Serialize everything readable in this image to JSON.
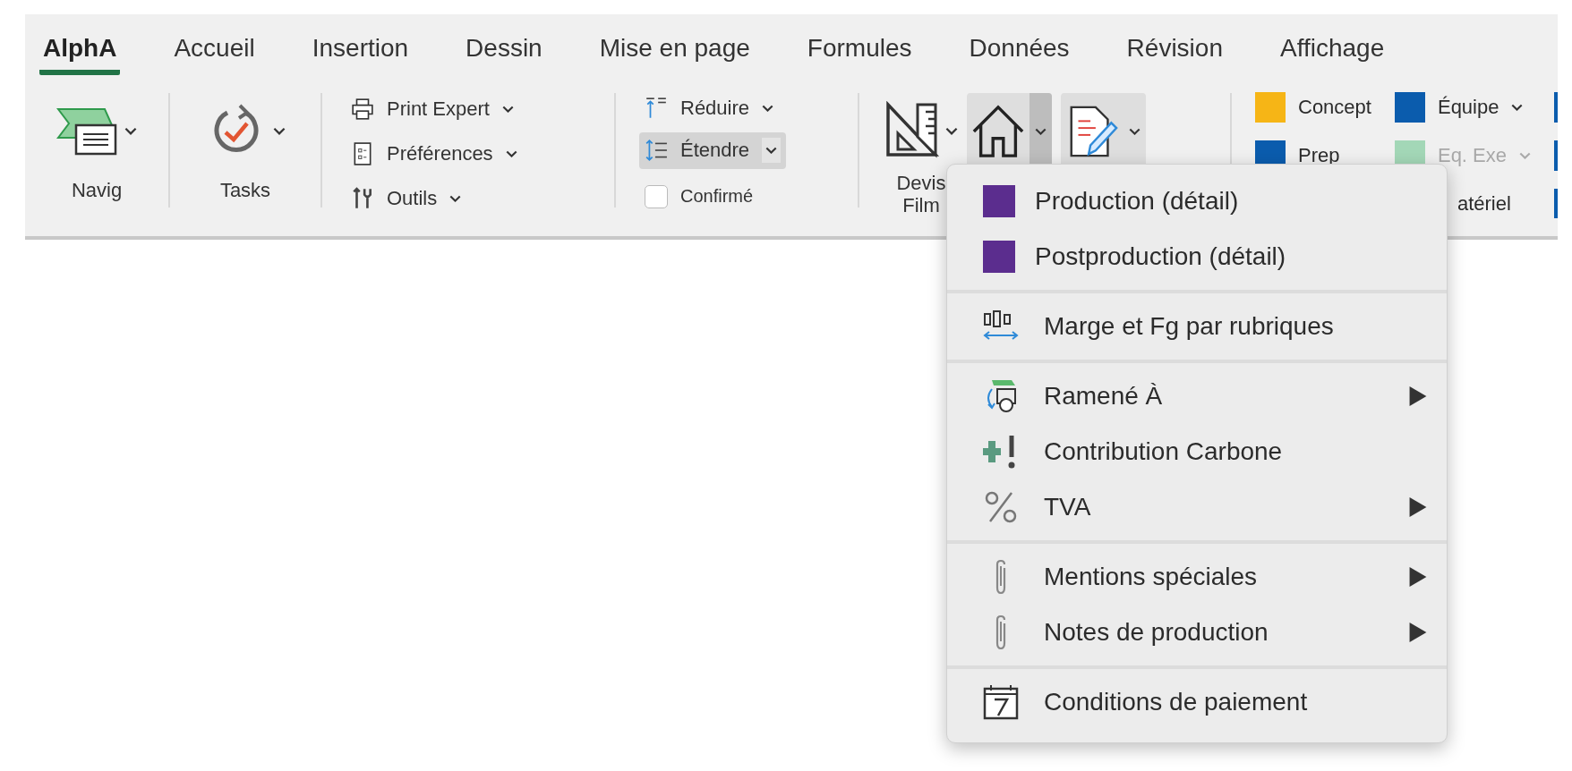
{
  "tabs": [
    {
      "label": "AlphA",
      "selected": true
    },
    {
      "label": "Accueil",
      "selected": false
    },
    {
      "label": "Insertion",
      "selected": false
    },
    {
      "label": "Dessin",
      "selected": false
    },
    {
      "label": "Mise en page",
      "selected": false
    },
    {
      "label": "Formules",
      "selected": false
    },
    {
      "label": "Données",
      "selected": false
    },
    {
      "label": "Révision",
      "selected": false
    },
    {
      "label": "Affichage",
      "selected": false
    }
  ],
  "ribbon": {
    "navig": {
      "label": "Navig"
    },
    "tasks": {
      "label": "Tasks"
    },
    "commands": [
      {
        "label": "Print Expert",
        "kind": "printer"
      },
      {
        "label": "Préférences",
        "kind": "list"
      },
      {
        "label": "Outils",
        "kind": "tools"
      }
    ],
    "outline": [
      {
        "label": "Réduire",
        "kind": "collapse",
        "selected": false
      },
      {
        "label": "Étendre",
        "kind": "expand",
        "selected": true
      }
    ],
    "confirmed": {
      "label": "Confirmé",
      "checked": false
    },
    "devis": {
      "label": "Devis Film"
    },
    "home_button": {
      "pressed": true,
      "open": true
    },
    "edit_button": {
      "pressed": true,
      "open": false
    },
    "legend": [
      [
        {
          "label": "Concept",
          "color": "#f6b516",
          "disabled": false,
          "dropdown": false,
          "covered": false
        },
        {
          "label": "Prep",
          "color": "#0b5cad",
          "disabled": false,
          "dropdown": false,
          "covered": false
        }
      ],
      [
        {
          "label": "Équipe",
          "color": "#0b5cad",
          "disabled": false,
          "dropdown": true,
          "covered": false
        },
        {
          "label": "Eq. Exe",
          "color": "#a3d7b7",
          "disabled": true,
          "dropdown": true,
          "covered": false
        },
        {
          "label": "atériel",
          "disabled": false,
          "dropdown": false,
          "covered": true
        }
      ],
      [
        {
          "color": "#0b5cad"
        },
        {
          "color": "#0b5cad"
        },
        {
          "color": "#0b5cad"
        }
      ]
    ]
  },
  "menu": {
    "sections": [
      [
        {
          "label": "Production (détail)",
          "kind": "swatch",
          "color": "#5b2d8e",
          "submenu": false
        },
        {
          "label": "Postproduction (détail)",
          "kind": "swatch",
          "color": "#5b2d8e",
          "submenu": false
        }
      ],
      [
        {
          "label": "Marge et Fg par rubriques",
          "kind": "margin",
          "submenu": false
        }
      ],
      [
        {
          "label": "Ramené À",
          "kind": "reassign",
          "submenu": true
        },
        {
          "label": "Contribution Carbone",
          "kind": "carbon",
          "submenu": false
        },
        {
          "label": "TVA",
          "kind": "percent",
          "submenu": true
        }
      ],
      [
        {
          "label": "Mentions spéciales",
          "kind": "clip",
          "submenu": true
        },
        {
          "label": "Notes de production",
          "kind": "clip",
          "submenu": true
        }
      ],
      [
        {
          "label": "Conditions de paiement",
          "kind": "calendar",
          "submenu": false
        }
      ]
    ]
  }
}
